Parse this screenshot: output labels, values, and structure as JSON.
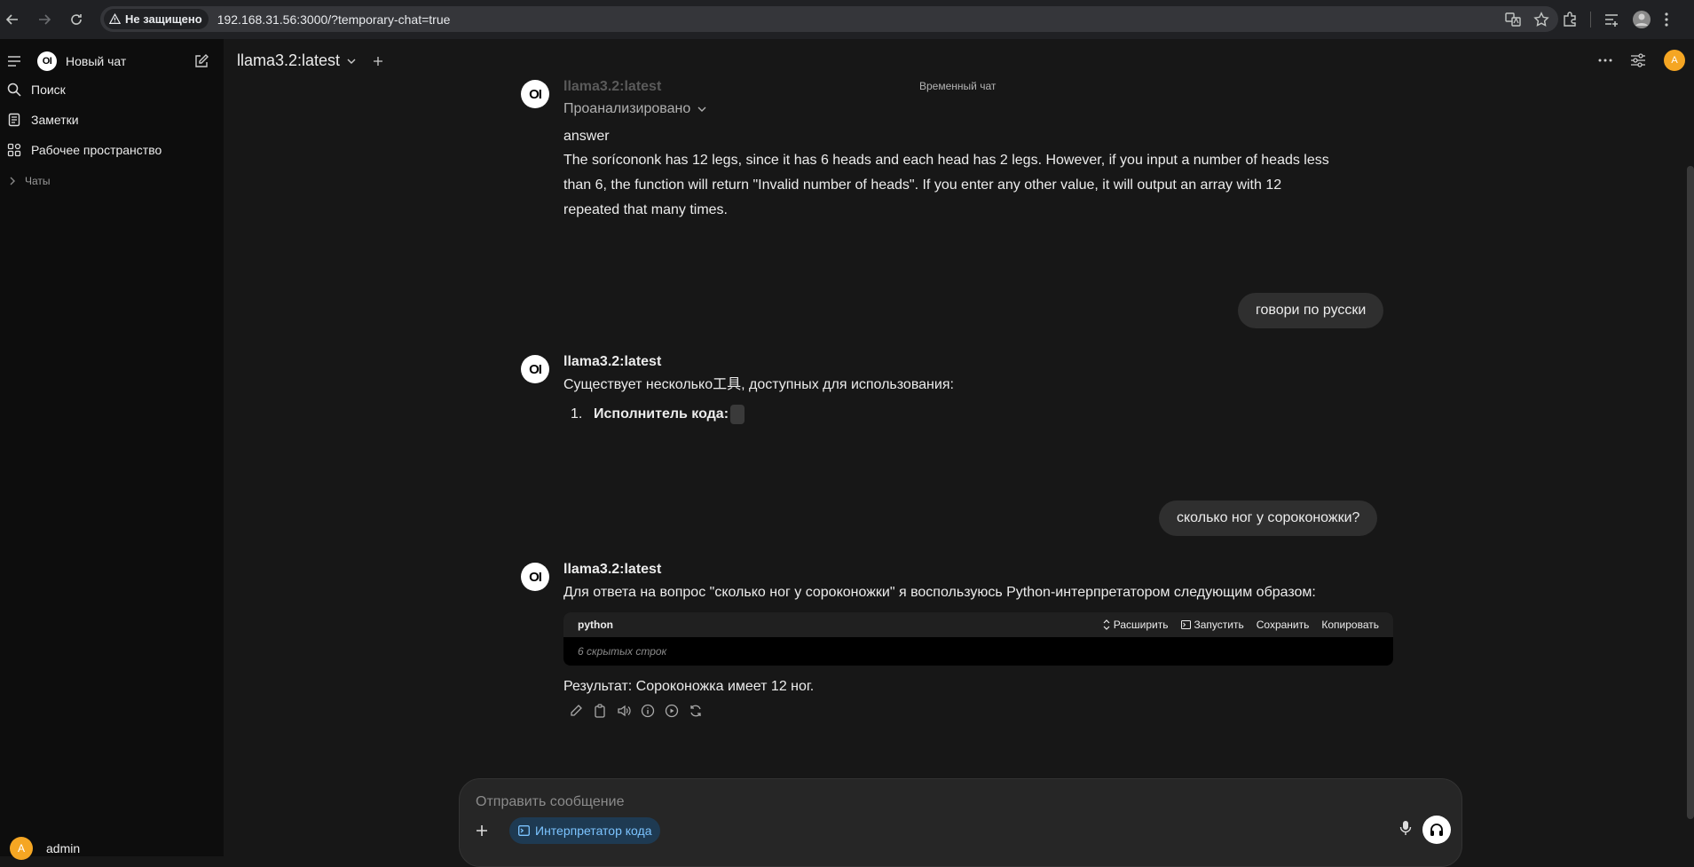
{
  "browser": {
    "security_label": "Не защищено",
    "url": "192.168.31.56:3000/?temporary-chat=true"
  },
  "sidebar": {
    "logo_text": "OI",
    "new_chat_label": "Новый чат",
    "items": [
      {
        "label": "Поиск",
        "icon": "search-icon"
      },
      {
        "label": "Заметки",
        "icon": "notes-icon"
      },
      {
        "label": "Рабочее пространство",
        "icon": "workspace-icon"
      }
    ],
    "chats_section_label": "Чаты",
    "user": {
      "avatar_letter": "A",
      "name": "admin"
    }
  },
  "header": {
    "model_name": "llama3.2:latest",
    "temporary_chat_label": "Временный чат",
    "avatar_letter": "A"
  },
  "conversation": {
    "model_logo_text": "OI",
    "msg1": {
      "model": "llama3.2:latest",
      "status": "Проанализировано",
      "answer_label": "answer",
      "lines": [
        "The sorícononk has 12 legs, since it has 6 heads and each head has 2 legs. However, if you input a number of heads less",
        "than 6, the function will return \"Invalid number of heads\". If you enter any other value, it will output an array with 12",
        "repeated that many times."
      ]
    },
    "user1": "говори по русски",
    "msg2": {
      "model": "llama3.2:latest",
      "text": "Существует несколько工具, доступных для использования:",
      "list_number": "1.",
      "list_item": "Исполнитель кода:"
    },
    "user2": "сколько ног у сороконожки?",
    "msg3": {
      "model": "llama3.2:latest",
      "text": "Для ответа на вопрос \"сколько ног у сороконожки\" я воспользуюсь Python-интерпретатором следующим образом:",
      "code": {
        "lang": "python",
        "expand": "Расширить",
        "run": "Запустить",
        "save": "Сохранить",
        "copy": "Копировать",
        "hidden": "6 скрытых строк"
      },
      "result": "Результат: Сороконожка имеет 12 ног."
    }
  },
  "composer": {
    "placeholder": "Отправить сообщение",
    "tool_chip": "Интерпретатор кода"
  }
}
